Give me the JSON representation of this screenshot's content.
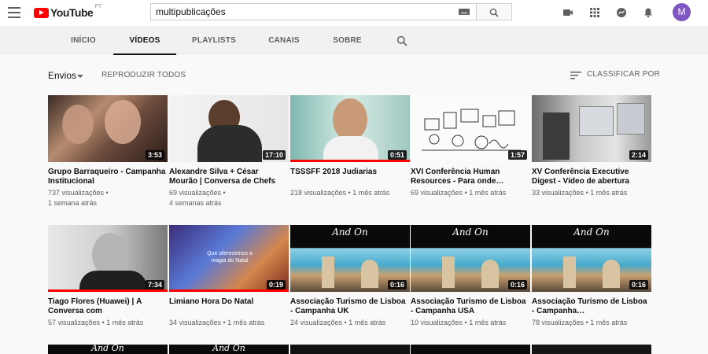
{
  "masthead": {
    "logo_text": "YouTube",
    "logo_country": "PT",
    "search_value": "multipublicações",
    "avatar_letter": "M"
  },
  "tabs": [
    "INÍCIO",
    "VÍDEOS",
    "PLAYLISTS",
    "CANAIS",
    "SOBRE"
  ],
  "active_tab": "VÍDEOS",
  "toolbar": {
    "sort_filter": "Envios",
    "play_all": "REPRODUZIR TODOS",
    "sort_label": "CLASSIFICAR POR"
  },
  "videos": [
    {
      "title": "Grupo Barraqueiro - Campanha Institucional",
      "views": "737 visualizações",
      "age": "1 semana atrás",
      "duration": "3:53",
      "progress": 0
    },
    {
      "title": "Alexandre Silva + César Mourão | Conversa de Chefs",
      "views": "69 visualizações",
      "age": "4 semanas atrás",
      "duration": "17:10",
      "progress": 0
    },
    {
      "title": "TSSSFF 2018 Judiarias",
      "views": "218 visualizações",
      "age": "1 mês atrás",
      "duration": "0:51",
      "progress": 100
    },
    {
      "title": "XVI Conferência Human Resources - Para onde…",
      "views": "69 visualizações",
      "age": "1 mês atrás",
      "duration": "1:57",
      "progress": 0
    },
    {
      "title": "XV Conferência Executive Digest - Vídeo de abertura",
      "views": "33 visualizações",
      "age": "1 mês atrás",
      "duration": "2:14",
      "progress": 0
    },
    {
      "title": "Tiago Flores (Huawei) | À Conversa com",
      "views": "57 visualizações",
      "age": "1 mês atrás",
      "duration": "7:34",
      "progress": 100
    },
    {
      "title": "Limiano Hora Do Natal",
      "views": "34 visualizações",
      "age": "1 mês atrás",
      "duration": "0:19",
      "progress": 100,
      "thumb_caption": "Que oferecemos a magia do Natal"
    },
    {
      "title": "Associação Turismo de Lisboa - Campanha UK",
      "views": "24 visualizações",
      "age": "1 mês atrás",
      "duration": "0:16",
      "progress": 0,
      "thumb_caption": "And On"
    },
    {
      "title": "Associação Turismo de Lisboa - Campanha USA",
      "views": "10 visualizações",
      "age": "1 mês atrás",
      "duration": "0:16",
      "progress": 0,
      "thumb_caption": "And On"
    },
    {
      "title": "Associação Turismo de Lisboa - Campanha…",
      "views": "78 visualizações",
      "age": "1 mês atrás",
      "duration": "0:16",
      "progress": 0,
      "thumb_caption": "And On"
    }
  ],
  "partial_row_captions": [
    "And On",
    "And On"
  ],
  "colors": {
    "brand_red": "#ff0000",
    "avatar": "#7e57c2"
  }
}
